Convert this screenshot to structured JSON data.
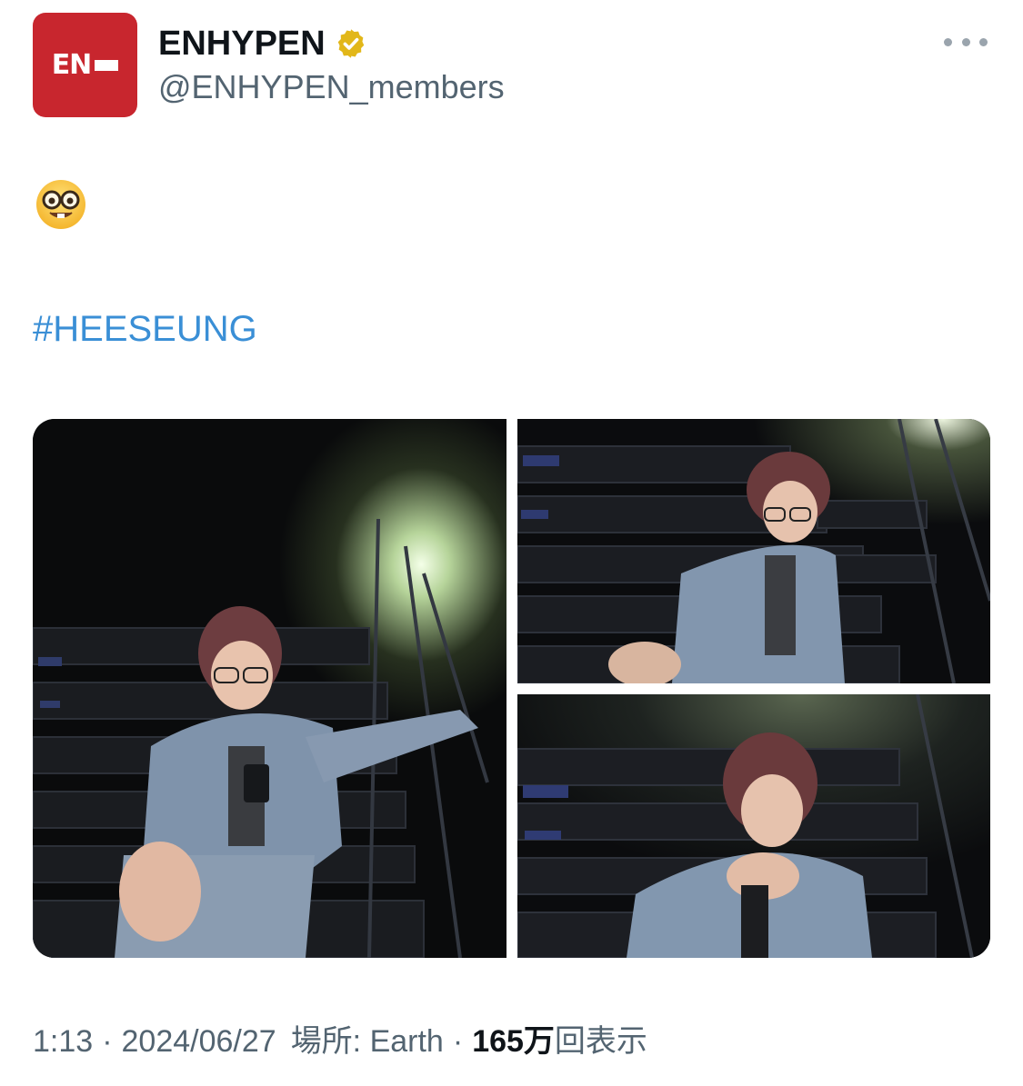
{
  "author": {
    "display_name": "ENHYPEN",
    "handle": "@ENHYPEN_members",
    "avatar_text": "EN",
    "verified": true
  },
  "tweet": {
    "emoji": "nerd-face",
    "hashtag": "#HEESEUNG"
  },
  "media": [
    {
      "alt": "photo-1"
    },
    {
      "alt": "photo-2"
    },
    {
      "alt": "photo-3"
    }
  ],
  "meta": {
    "time": "1:13",
    "separator": "·",
    "date": "2024/06/27",
    "location": "場所: Earth",
    "views_count": "165万",
    "views_label": "回表示"
  },
  "colors": {
    "avatar_bg": "#c8262e",
    "verified_gold": "#e2b719",
    "hashtag": "#3a8fd6",
    "secondary_text": "#536471"
  }
}
